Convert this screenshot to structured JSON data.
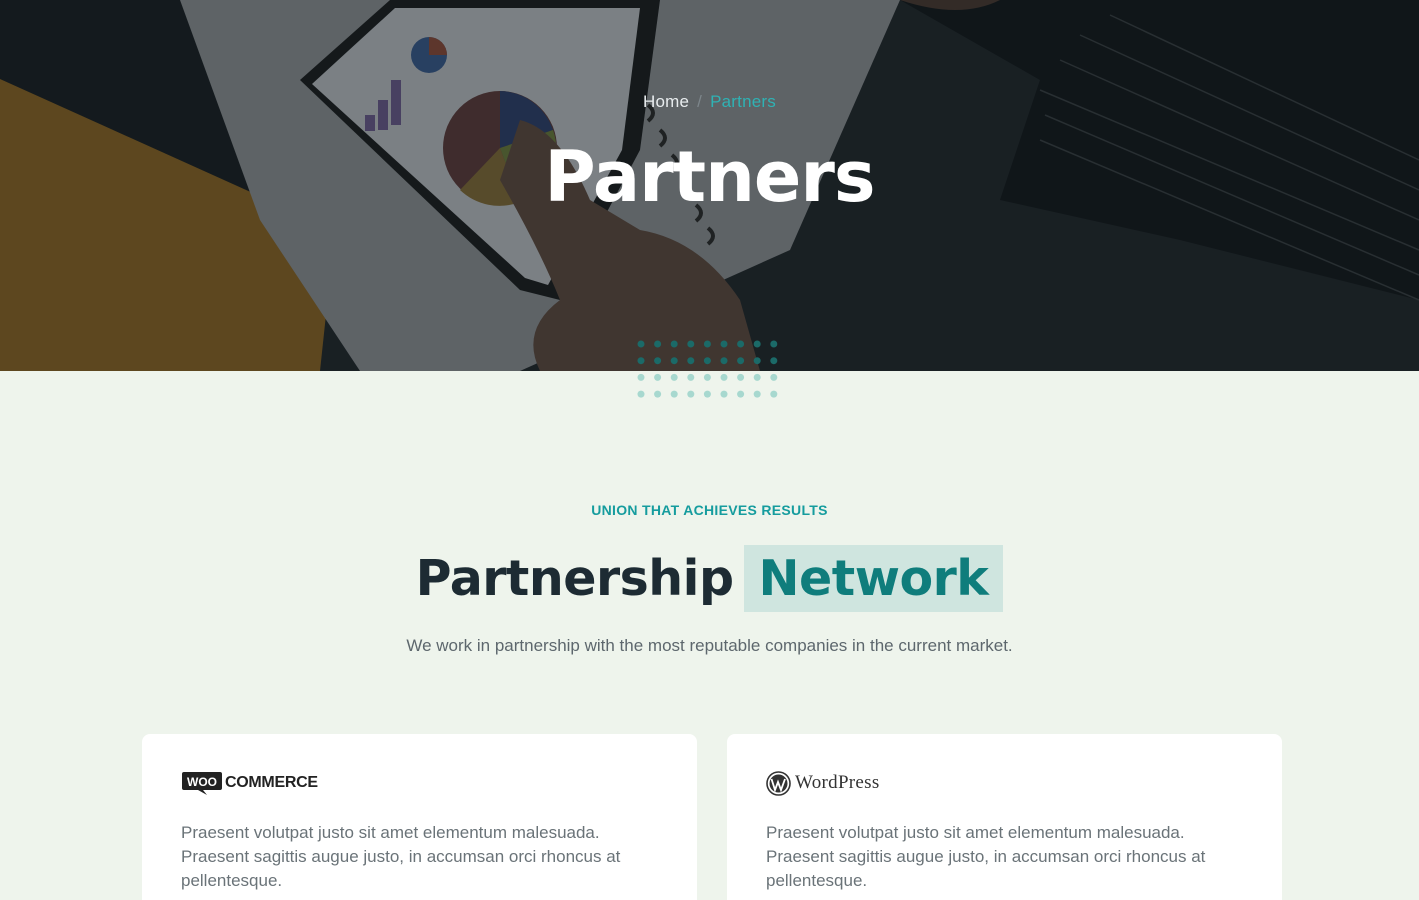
{
  "hero": {
    "breadcrumb": {
      "home": "Home",
      "separator": "/",
      "current": "Partners"
    },
    "title": "Partners"
  },
  "section": {
    "kicker": "UNION THAT ACHIEVES RESULTS",
    "title_main": "Partnership",
    "title_highlight": "Network",
    "subtitle": "We work in partnership with the most reputable companies in the current market."
  },
  "partners": [
    {
      "logo_icon": "woocommerce-logo-icon",
      "logo_badge": "WOO",
      "logo_text": "COMMERCE",
      "description": "Praesent volutpat justo sit amet elementum malesuada. Praesent sagittis augue justo, in accumsan orci rhoncus at pellentesque."
    },
    {
      "logo_icon": "wordpress-logo-icon",
      "logo_text": "WordPress",
      "description": "Praesent volutpat justo sit amet elementum malesuada. Praesent sagittis augue justo, in accumsan orci rhoncus at pellentesque."
    }
  ],
  "colors": {
    "accent": "#2fb2b4",
    "heading": "#1d2b33",
    "highlight_bg": "#cfe5df",
    "highlight_text": "#0f7d7c",
    "section_bg": "#eef4ec"
  }
}
